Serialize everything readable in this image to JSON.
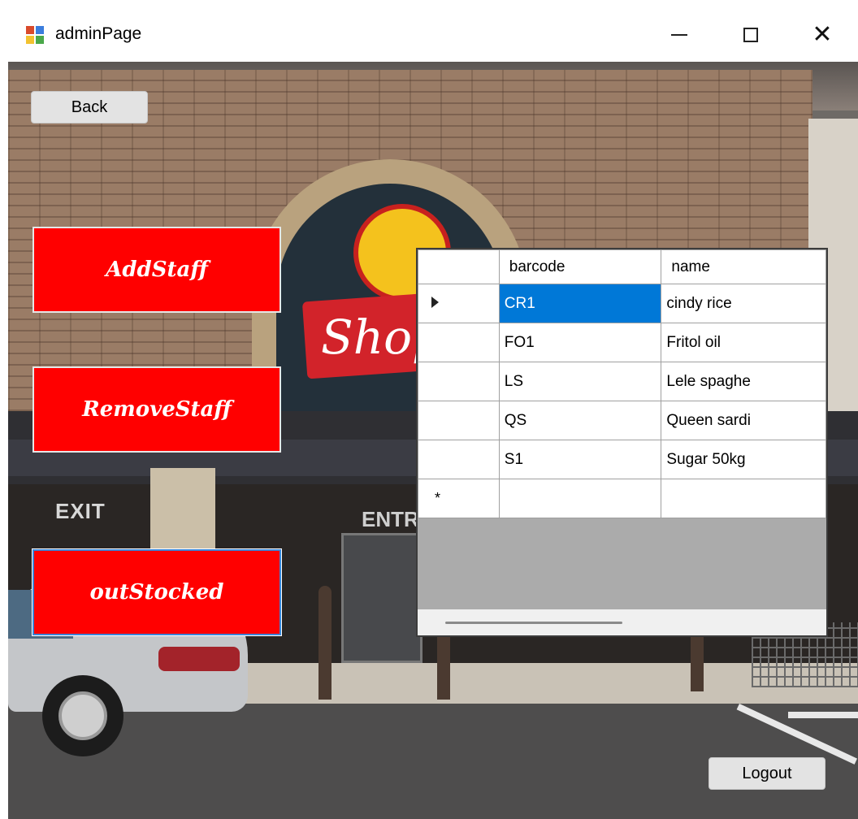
{
  "window": {
    "title": "adminPage",
    "controls": {
      "minimize": "—",
      "maximize": "☐",
      "close": "✕"
    }
  },
  "toolbar": {
    "back_label": "Back",
    "logout_label": "Logout"
  },
  "actions": {
    "add_staff": "AddStaff",
    "remove_staff": "RemoveStaff",
    "out_stocked": "outStocked"
  },
  "background": {
    "exit_sign": "EXIT",
    "entrance_sign": "ENTRA",
    "store_logo": "Shop"
  },
  "grid": {
    "columns": [
      "barcode",
      "name"
    ],
    "rows": [
      {
        "barcode": "CR1",
        "name": "cindy rice",
        "current": true
      },
      {
        "barcode": "FO1",
        "name": "Fritol oil"
      },
      {
        "barcode": "LS",
        "name": "Lele spaghe"
      },
      {
        "barcode": "QS",
        "name": "Queen sardi"
      },
      {
        "barcode": "S1",
        "name": "Sugar 50kg"
      }
    ],
    "new_row_marker": "*",
    "selection_color": "#0078d7"
  },
  "colors": {
    "action_button": "#ff0000",
    "focus_border": "#3b86d9"
  }
}
